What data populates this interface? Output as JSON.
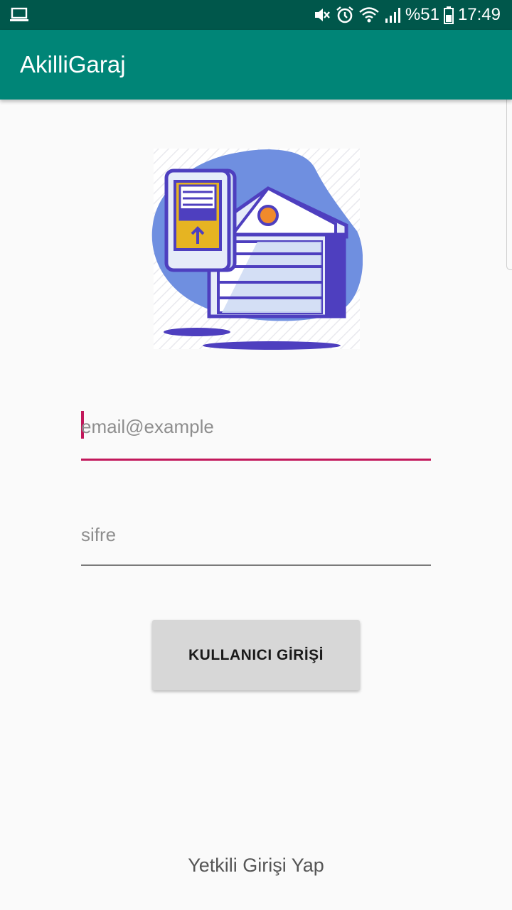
{
  "status_bar": {
    "battery_percent": "%51",
    "time": "17:49",
    "icons": [
      "laptop-icon",
      "mute-icon",
      "alarm-icon",
      "wifi-icon",
      "signal-icon",
      "battery-icon"
    ]
  },
  "app_bar": {
    "title": "AkilliGaraj"
  },
  "hero": {
    "icon": "smart-garage-illustration"
  },
  "email_field": {
    "placeholder": "email@example",
    "value": ""
  },
  "password_field": {
    "placeholder": "sifre",
    "value": ""
  },
  "login_button": {
    "label": "KULLANICI GİRİŞİ"
  },
  "admin_link": {
    "label": "Yetkili Girişi Yap"
  },
  "colors": {
    "status_bar": "#00574b",
    "app_bar": "#008577",
    "accent": "#c2185b",
    "button": "#d7d7d7",
    "background": "#fafafa"
  }
}
